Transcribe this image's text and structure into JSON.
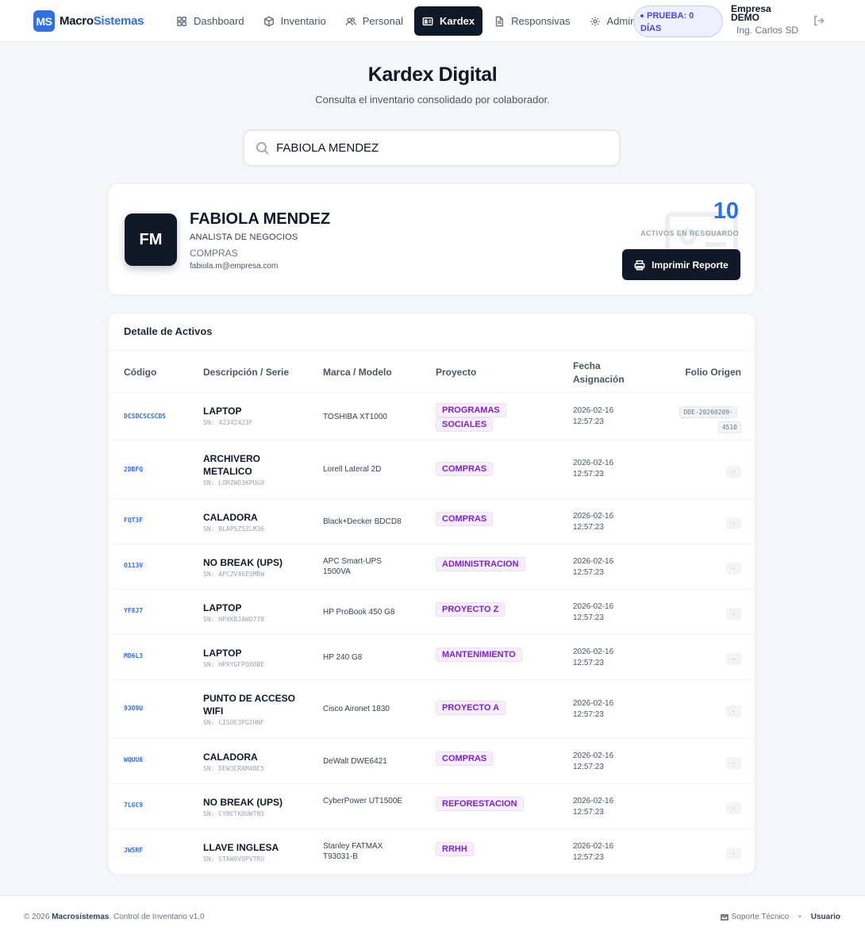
{
  "brand": {
    "mark": "MS",
    "name_a": "Macro",
    "name_b": "Sistemas"
  },
  "nav": {
    "dashboard": "Dashboard",
    "inventario": "Inventario",
    "personal": "Personal",
    "kardex": "Kardex",
    "responsivas": "Responsivas",
    "admin": "Admin"
  },
  "trial": {
    "line1": "PRUEBA: 0",
    "line2": "DÍAS"
  },
  "company": {
    "line1": "Empresa",
    "line2": "DEMO",
    "user": "Ing. Carlos SD"
  },
  "hero": {
    "title": "Kardex Digital",
    "subtitle": "Consulta el inventario consolidado por colaborador."
  },
  "search": {
    "value": "FABIOLA MENDEZ"
  },
  "profile": {
    "initials": "FM",
    "name": "FABIOLA MENDEZ",
    "role": "ANALISTA DE NEGOCIOS",
    "department": "COMPRAS",
    "email": "fabiola.m@empresa.com",
    "asset_count": "10",
    "asset_count_label": "ACTIVOS EN RESGUARDO",
    "print_label": "Imprimir Reporte"
  },
  "table": {
    "title": "Detalle de Activos",
    "headers": {
      "code": "Código",
      "desc": "Descripción / Serie",
      "model": "Marca / Modelo",
      "project": "Proyecto",
      "date_a": "Fecha",
      "date_b": "Asignación",
      "folio": "Folio Origen"
    },
    "rows": [
      {
        "code": "DCSDCSCSCDS",
        "desc": "LAPTOP",
        "serial": "SN: 42342423F",
        "model": "TOSHIBA XT1000",
        "project": "PROGRAMAS SOCIALES",
        "date": "2026-02-16",
        "time": "12:57:23",
        "folio": "DDE-20260209-4510"
      },
      {
        "code": "2DBFQ",
        "desc": "ARCHIVERO METALICO",
        "serial": "SN: LORZWD3KPUG9",
        "model": "Lorell Lateral 2D",
        "project": "COMPRAS",
        "date": "2026-02-16",
        "time": "12:57:23",
        "folio": "-"
      },
      {
        "code": "FQT3F",
        "desc": "CALADORA",
        "serial": "SN: BLAP5Z5ZLM36",
        "model": "Black+Decker BDCD8",
        "project": "COMPRAS",
        "date": "2026-02-16",
        "time": "12:57:23",
        "folio": "-"
      },
      {
        "code": "O113V",
        "desc": "NO BREAK (UPS)",
        "serial": "SN: APCZV46ESMRW",
        "model": "APC Smart-UPS 1500VA",
        "project": "ADMINISTRACION",
        "date": "2026-02-16",
        "time": "12:57:23",
        "folio": "-"
      },
      {
        "code": "YF8J7",
        "desc": "LAPTOP",
        "serial": "SN: HPXKRJAWO778",
        "model": "HP ProBook 450 G8",
        "project": "PROYECTO Z",
        "date": "2026-02-16",
        "time": "12:57:23",
        "folio": "-"
      },
      {
        "code": "MD6L3",
        "desc": "LAPTOP",
        "serial": "SN: HPXYGFPQXO8E",
        "model": "HP 240 G8",
        "project": "MANTENIMIENTO",
        "date": "2026-02-16",
        "time": "12:57:23",
        "folio": "-"
      },
      {
        "code": "93O9U",
        "desc": "PUNTO DE ACCESO WIFI",
        "serial": "SN: CISOE3PGIHNF",
        "model": "Cisco Aironet 1830",
        "project": "PROYECTO A",
        "date": "2026-02-16",
        "time": "12:57:23",
        "folio": "-"
      },
      {
        "code": "WQUU8",
        "desc": "CALADORA",
        "serial": "SN: DEW3ERAM4BE5",
        "model": "DeWalt DWE6421",
        "project": "COMPRAS",
        "date": "2026-02-16",
        "time": "12:57:23",
        "folio": "-"
      },
      {
        "code": "7LGC9",
        "desc": "NO BREAK (UPS)",
        "serial": "SN: CYBETKDUWTN5",
        "model": "CyberPower UT1500E",
        "project": "REFORESTACION",
        "date": "2026-02-16",
        "time": "12:57:23",
        "folio": "-"
      },
      {
        "code": "JW5RF",
        "desc": "LLAVE INGLESA",
        "serial": "SN: STAW0VQPVTRU",
        "model": "Stanley FATMAX T93031-B",
        "project": "RRHH",
        "date": "2026-02-16",
        "time": "12:57:23",
        "folio": "-"
      }
    ]
  },
  "footer": {
    "copyright": "© 2026",
    "brand": "Macrosistemas",
    "tagline": ". Control de Inventario v1.0",
    "support": "Soporte Técnico",
    "sep": "•",
    "user": "Usuario"
  },
  "colors": {
    "accent": "#2f6fe6",
    "dark": "#111827",
    "project": "#7e22ce",
    "trial": "#4f46e5"
  }
}
